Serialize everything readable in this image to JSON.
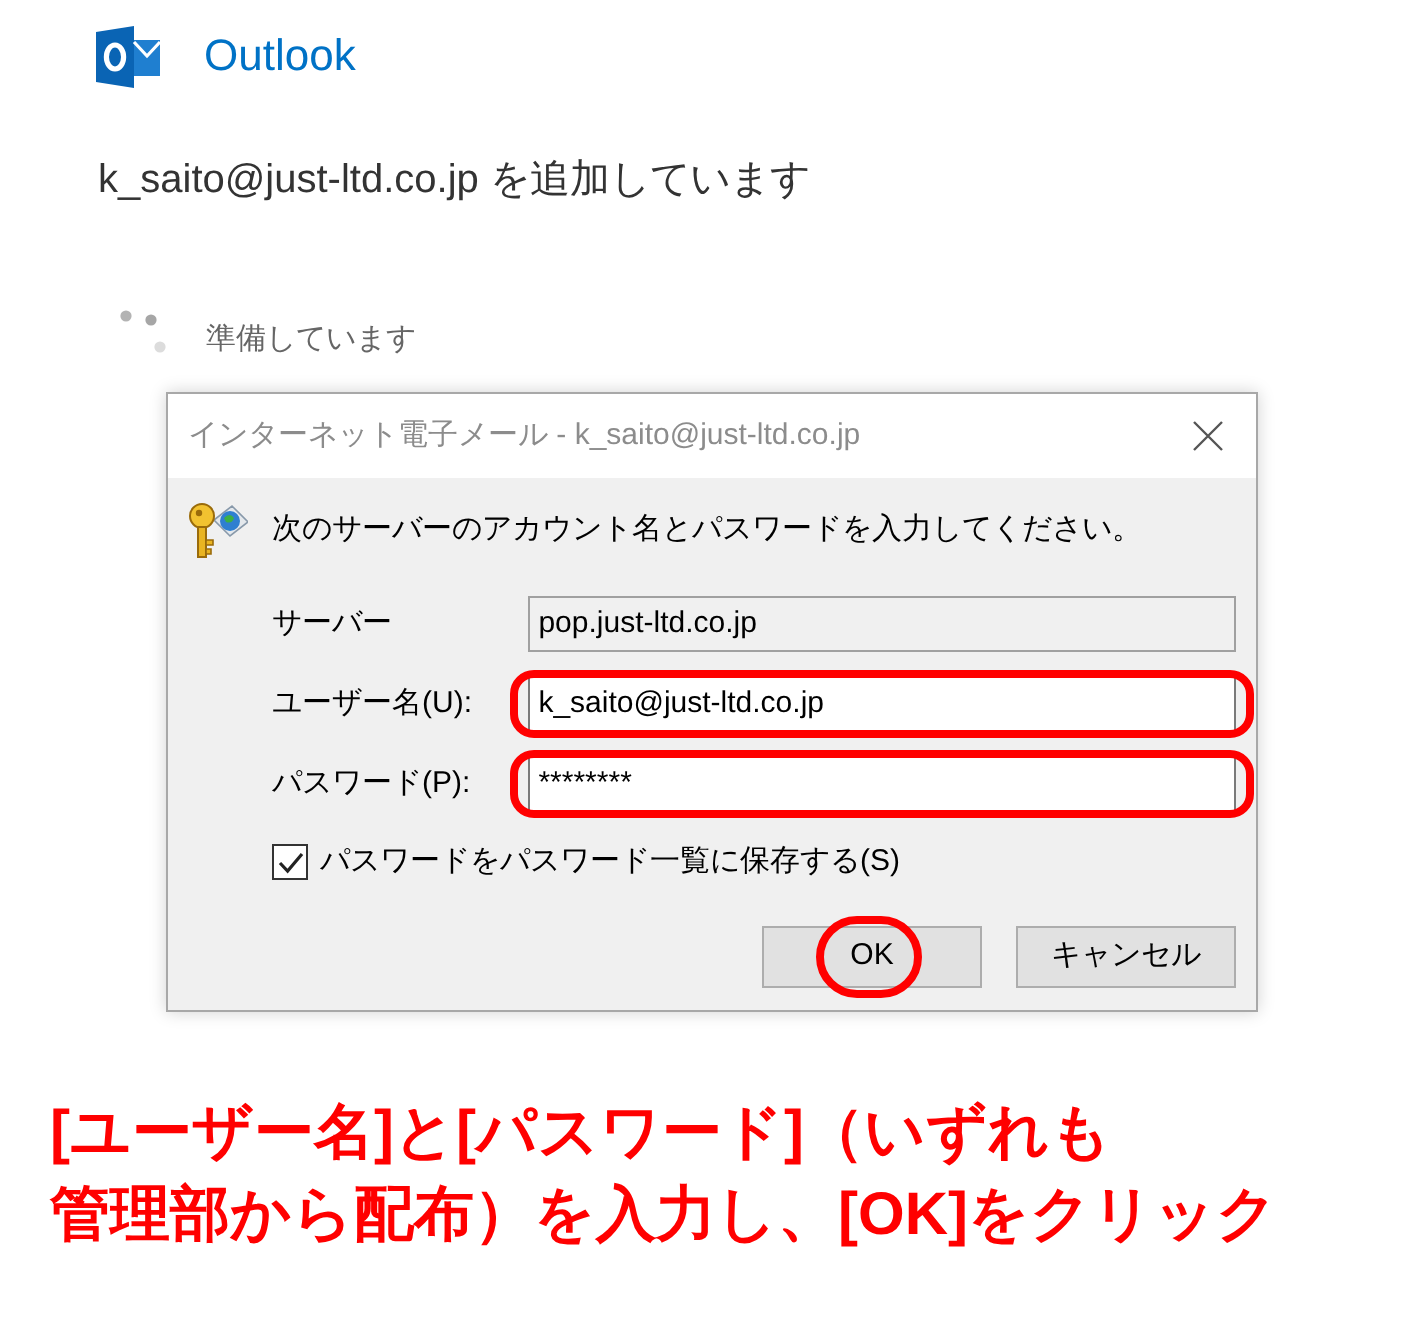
{
  "app": {
    "name": "Outlook"
  },
  "status": {
    "heading": "k_saito@just-ltd.co.jp を追加しています",
    "progress_text": "準備しています"
  },
  "dialog": {
    "title": "インターネット電子メール - k_saito@just-ltd.co.jp",
    "message": "次のサーバーのアカウント名とパスワードを入力してください。",
    "fields": [
      {
        "label": "サーバー",
        "value": "pop.just-ltd.co.jp",
        "disabled": true,
        "highlighted": false
      },
      {
        "label": "ユーザー名(U):",
        "value": "k_saito@just-ltd.co.jp",
        "disabled": false,
        "highlighted": true
      },
      {
        "label": "パスワード(P):",
        "value": "********",
        "disabled": false,
        "highlighted": true
      }
    ],
    "save_password": {
      "label": "パスワードをパスワード一覧に保存する(S)",
      "checked": true
    },
    "buttons": [
      {
        "label": "OK",
        "highlighted": true
      },
      {
        "label": "キャンセル",
        "highlighted": false
      }
    ]
  },
  "caption": {
    "lines": [
      "[ユーザー名]と[パスワード]（いずれも",
      "管理部から配布）を入力し、[OK]をクリック"
    ]
  }
}
